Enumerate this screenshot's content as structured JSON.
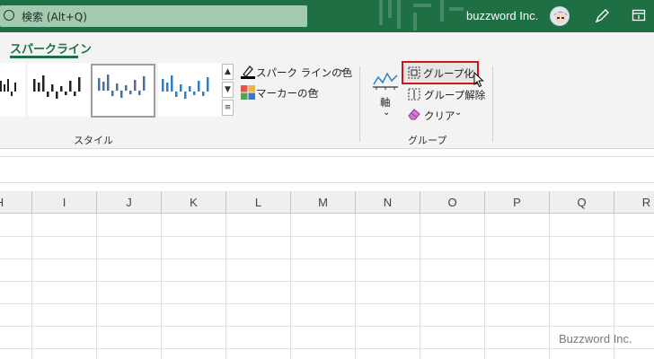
{
  "titlebar": {
    "search_placeholder": "検索 (Alt+Q)",
    "account_name": "buzzword Inc."
  },
  "ribbon": {
    "active_tab": "スパークライン",
    "style_group": {
      "label": "スタイル",
      "gallery": [
        {
          "name": "black",
          "color": "#222222",
          "selected": false
        },
        {
          "name": "blue-dark",
          "color": "#4a6f9a",
          "selected": true
        },
        {
          "name": "blue",
          "color": "#2f7fc1",
          "selected": false
        }
      ],
      "sparkline_color_label": "スパーク ラインの色",
      "marker_color_label": "マーカーの色"
    },
    "group_group": {
      "label": "グループ",
      "axis_label": "軸",
      "group_label": "グループ化",
      "ungroup_label": "グループ解除",
      "clear_label": "クリア"
    }
  },
  "grid": {
    "columns": [
      "H",
      "I",
      "J",
      "K",
      "L",
      "M",
      "N",
      "O",
      "P",
      "Q",
      "R"
    ]
  },
  "watermark": "Buzzword Inc.",
  "colors": {
    "excel_green": "#1e6f44",
    "highlight_red": "#c8171d"
  }
}
